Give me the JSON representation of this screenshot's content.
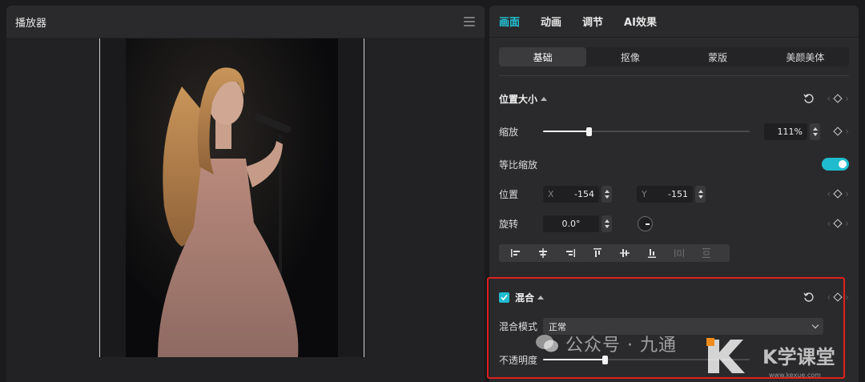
{
  "player": {
    "title": "播放器"
  },
  "tabs": [
    {
      "label": "画面",
      "active": true
    },
    {
      "label": "动画",
      "active": false
    },
    {
      "label": "调节",
      "active": false
    },
    {
      "label": "AI效果",
      "active": false
    }
  ],
  "subtabs": [
    {
      "label": "基础",
      "active": true
    },
    {
      "label": "抠像",
      "active": false
    },
    {
      "label": "蒙版",
      "active": false
    },
    {
      "label": "美颜美体",
      "active": false
    }
  ],
  "position_size": {
    "title": "位置大小",
    "scale_label": "缩放",
    "scale_value": "111%",
    "scale_fraction": 0.22,
    "uniform_scale_label": "等比缩放",
    "uniform_scale_on": true,
    "position_label": "位置",
    "x_label": "X",
    "x_value": "-154",
    "y_label": "Y",
    "y_value": "-151",
    "rotation_label": "旋转",
    "rotation_value": "0.0°"
  },
  "blend": {
    "title": "混合",
    "enabled": true,
    "mode_label": "混合模式",
    "mode_value": "正常",
    "opacity_label": "不透明度",
    "opacity_fraction": 0.3
  },
  "colors": {
    "accent": "#1fbccf",
    "highlight_box": "#e02020"
  },
  "watermark": {
    "text": "公众号 · 九通",
    "brand": "K学课堂",
    "url": "www.kexue.com"
  }
}
